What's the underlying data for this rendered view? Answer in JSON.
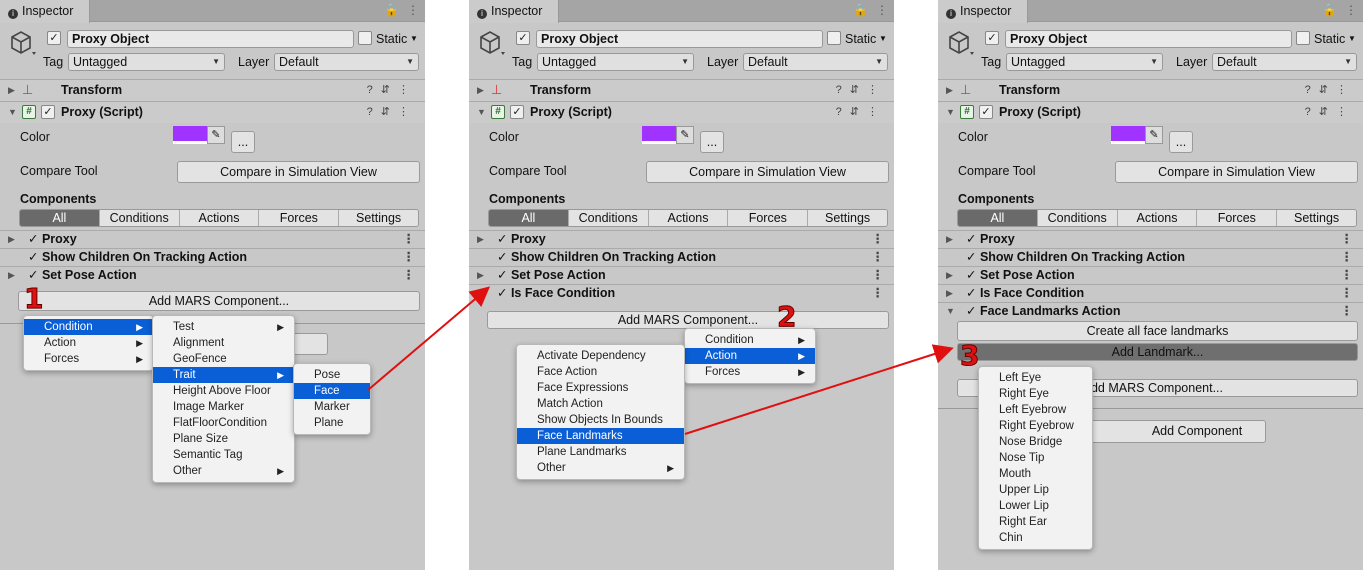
{
  "tab_title": "Inspector",
  "object_name": "Proxy Object",
  "static_label": "Static",
  "tag_label": "Tag",
  "tag_value": "Untagged",
  "layer_label": "Layer",
  "layer_value": "Default",
  "transform_label": "Transform",
  "script_label": "Proxy (Script)",
  "color_label": "Color",
  "color_value": "#a033ff",
  "ellipsis_btn": "...",
  "compare_label": "Compare Tool",
  "compare_btn": "Compare in Simulation View",
  "components_label": "Components",
  "filters": [
    "All",
    "Conditions",
    "Actions",
    "Forces",
    "Settings"
  ],
  "add_mars": "Add MARS Component...",
  "add_component": "Add Component",
  "panel1": {
    "comps": [
      "Proxy",
      "Show Children On Tracking Action",
      "Set Pose Action"
    ],
    "step": "1",
    "menu1": [
      "Condition",
      "Action",
      "Forces"
    ],
    "menu2": [
      "Test",
      "Alignment",
      "GeoFence",
      "Trait",
      "Height Above Floor",
      "Image Marker",
      "FlatFloorCondition",
      "Plane Size",
      "Semantic Tag",
      "Other"
    ],
    "menu3": [
      "Pose",
      "Face",
      "Marker",
      "Plane"
    ]
  },
  "panel2": {
    "comps": [
      "Proxy",
      "Show Children On Tracking Action",
      "Set Pose Action",
      "Is Face Condition"
    ],
    "step": "2",
    "menu1": [
      "Condition",
      "Action",
      "Forces"
    ],
    "menu2": [
      "Activate Dependency",
      "Face Action",
      "Face Expressions",
      "Match Action",
      "Show Objects In Bounds",
      "Face Landmarks",
      "Plane Landmarks",
      "Other"
    ]
  },
  "panel3": {
    "comps": [
      "Proxy",
      "Show Children On Tracking Action",
      "Set Pose Action",
      "Is Face Condition",
      "Face Landmarks Action"
    ],
    "step": "3",
    "create_btn": "Create all face landmarks",
    "add_landmark": "Add Landmark...",
    "menu": [
      "Left Eye",
      "Right Eye",
      "Left Eyebrow",
      "Right Eyebrow",
      "Nose Bridge",
      "Nose Tip",
      "Mouth",
      "Upper Lip",
      "Lower Lip",
      "Right Ear",
      "Chin"
    ]
  },
  "colors": {
    "panel": "#c8c8c8",
    "selection": "#0a5fd6",
    "arrow": "#e01010"
  }
}
